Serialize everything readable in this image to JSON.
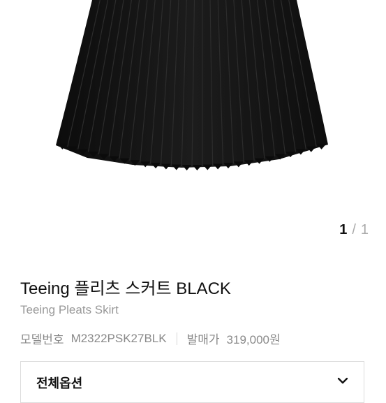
{
  "gallery": {
    "current": "1",
    "separator": "/",
    "total": "1",
    "image_subject": "black pleated skirt",
    "skirt_color": "#121212"
  },
  "product": {
    "title": "Teeing 플리츠 스커트 BLACK",
    "subtitle": "Teeing Pleats Skirt",
    "model_label": "모델번호",
    "model_value": "M2322PSK27BLK",
    "price_label": "발매가",
    "price_value": "319,000원"
  },
  "options": {
    "label": "전체옵션",
    "icon": "chevron-down-icon"
  }
}
